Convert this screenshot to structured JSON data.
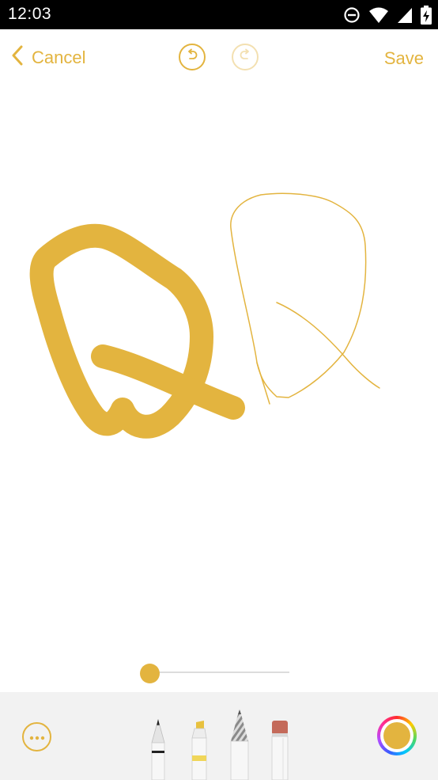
{
  "status_bar": {
    "time": "12:03",
    "icons": [
      "do-not-disturb-icon",
      "wifi-icon",
      "signal-icon",
      "battery-charging-icon"
    ]
  },
  "toolbar": {
    "cancel_label": "Cancel",
    "save_label": "Save",
    "undo_icon": "undo-icon",
    "redo_icon": "redo-icon",
    "redo_enabled": false
  },
  "drawing": {
    "stroke_color": "#E3B43F",
    "strokes": [
      "thick-letter-q",
      "thin-letter-q"
    ]
  },
  "size_slider": {
    "value": 0
  },
  "tool_tray": {
    "more_icon": "more-options-icon",
    "tools": [
      "pen",
      "marker",
      "pencil",
      "eraser"
    ],
    "current_color": "#E3B43F"
  },
  "colors": {
    "accent": "#E3B43F",
    "tray_background": "#f2f2f2",
    "status_bar": "#000000"
  }
}
